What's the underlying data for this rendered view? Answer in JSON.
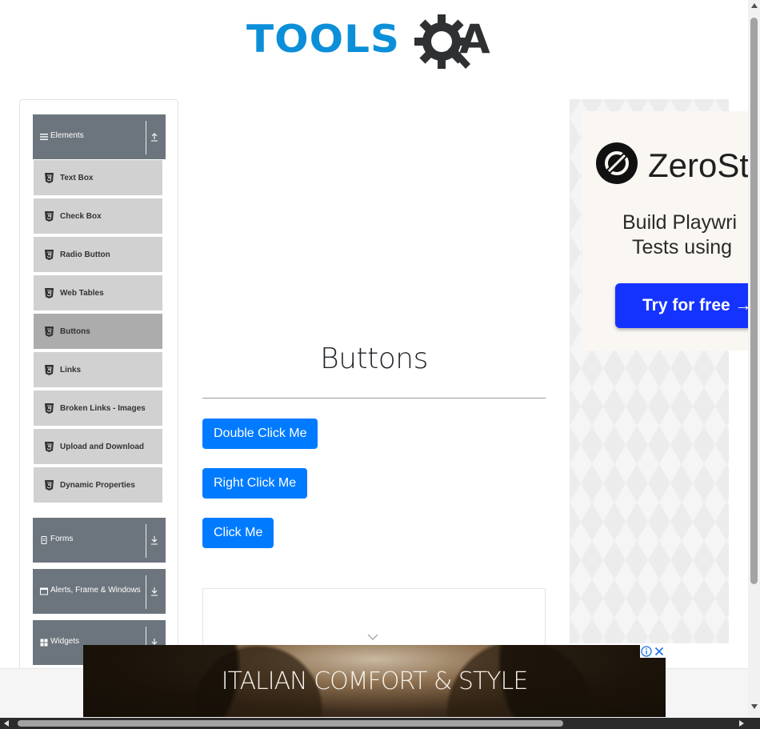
{
  "logo": {
    "part1": "TOOLS",
    "part2": "A",
    "colors": {
      "tools": "#0c8fd9",
      "qa": "#2f3032"
    }
  },
  "sidebar": {
    "groups": [
      {
        "label": "Elements",
        "icon": "hamburger-icon",
        "expanded": true
      },
      {
        "label": "Forms",
        "icon": "document-icon",
        "expanded": false
      },
      {
        "label": "Alerts, Frame & Windows",
        "icon": "window-icon",
        "expanded": false
      },
      {
        "label": "Widgets",
        "icon": "grid-icon",
        "expanded": false
      }
    ],
    "items": [
      {
        "label": "Text Box"
      },
      {
        "label": "Check Box"
      },
      {
        "label": "Radio Button"
      },
      {
        "label": "Web Tables"
      },
      {
        "label": "Buttons",
        "active": true
      },
      {
        "label": "Links"
      },
      {
        "label": "Broken Links - Images"
      },
      {
        "label": "Upload and Download"
      },
      {
        "label": "Dynamic Properties"
      }
    ]
  },
  "main": {
    "title": "Buttons",
    "buttons": {
      "double": "Double Click Me",
      "right": "Right Click Me",
      "click": "Click Me"
    }
  },
  "side_ad": {
    "brand": "ZeroSt",
    "headline_line1": "Build Playwri",
    "headline_line2": "Tests using",
    "cta": "Try for free →"
  },
  "bottom_ad": {
    "text": "ITALIAN COMFORT & STYLE"
  },
  "colors": {
    "primary": "#007bff",
    "sidebar_header": "#6c757d",
    "menu_item": "#d1d1d1",
    "menu_active": "#acacac"
  }
}
